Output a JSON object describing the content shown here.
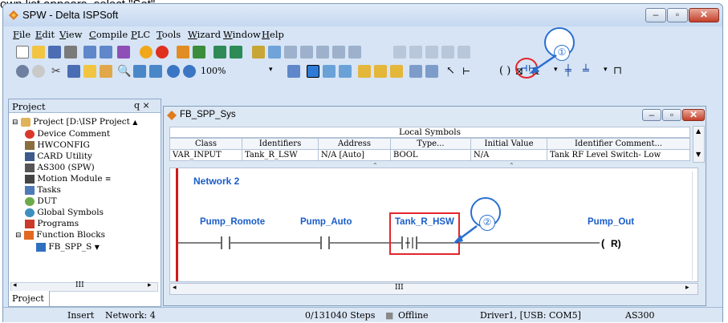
{
  "caption": "own list appears, select \"Set\".",
  "window": {
    "title": "SPW - Delta ISPSoft"
  },
  "menu": [
    "File",
    "Edit",
    "View",
    "Compile",
    "PLC",
    "Tools",
    "Wizard",
    "Window",
    "Help"
  ],
  "toolbar": {
    "zoom": "100%"
  },
  "project_panel": {
    "title": "Project",
    "pin": "q ×",
    "tab": "Project",
    "tree": [
      {
        "label": "Project [D:\\ISP Project",
        "icon": "project-icon"
      },
      {
        "label": "Device Comment",
        "icon": "device-comment-icon"
      },
      {
        "label": "HWCONFIG",
        "icon": "hwconfig-icon"
      },
      {
        "label": "CARD Utility",
        "icon": "card-utility-icon"
      },
      {
        "label": "AS300 (SPW)",
        "icon": "plc-icon"
      },
      {
        "label": "Motion Module",
        "icon": "motion-module-icon"
      },
      {
        "label": "Tasks",
        "icon": "tasks-icon"
      },
      {
        "label": "DUT",
        "icon": "dut-icon"
      },
      {
        "label": "Global Symbols",
        "icon": "global-symbols-icon"
      },
      {
        "label": "Programs",
        "icon": "programs-icon"
      },
      {
        "label": "Function Blocks",
        "icon": "function-blocks-icon"
      },
      {
        "label": "FB_SPP_S",
        "icon": "fb-icon"
      }
    ]
  },
  "child_window": {
    "title": "FB_SPP_Sys",
    "local_symbols_title": "Local Symbols",
    "columns": [
      "Class",
      "Identifiers",
      "Address",
      "Type...",
      "Initial Value",
      "Identifier Comment..."
    ],
    "rows": [
      [
        "VAR_INPUT",
        "Tank_R_LSW",
        "N/A [Auto]",
        "BOOL",
        "N/A",
        "Tank RF Level Switch- Low"
      ]
    ]
  },
  "ladder": {
    "network": "Network 2",
    "contacts": [
      {
        "name": "Pump_Romote",
        "type": "NO"
      },
      {
        "name": "Pump_Auto",
        "type": "NO"
      },
      {
        "name": "Tank_R_HSW",
        "type": "rising-edge"
      }
    ],
    "coil": {
      "name": "Pump_Out",
      "symbol": "(R)"
    }
  },
  "callouts": [
    "①",
    "②"
  ],
  "statusbar": {
    "mode": "Insert",
    "network": "Network: 4",
    "steps": "0/131040 Steps",
    "online": "Offline",
    "driver": "Driver1, [USB: COM5]",
    "plc": "AS300"
  },
  "colors": {
    "rail": "#d2181e",
    "ladder_text": "#1a5dc8",
    "highlight": "#e3262c",
    "callout": "#2a6fd0"
  }
}
